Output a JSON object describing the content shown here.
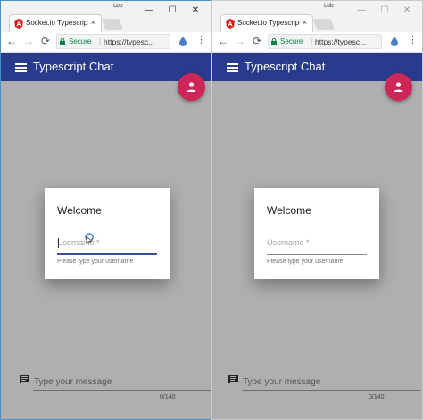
{
  "windows": [
    {
      "user_tag": "Lob",
      "tab": {
        "title": "Socket.io Typescript Cl",
        "close": "×"
      },
      "window_controls": {
        "minimize": "—",
        "maximize": "☐",
        "close": "✕"
      },
      "nav": {
        "back": "←",
        "forward": "→",
        "reload": "⟳"
      },
      "omnibox": {
        "secure_label": "Secure",
        "separator": "|",
        "url": "https://typesc..."
      },
      "menu": "⋮",
      "app": {
        "title": "Typescript Chat"
      },
      "dialog": {
        "title": "Welcome",
        "username_placeholder": "Username *",
        "hint": "Please type your username",
        "focused": true
      },
      "message": {
        "placeholder": "Type your message",
        "counter": "0/140"
      }
    },
    {
      "user_tag": "Lob",
      "tab": {
        "title": "Socket.io Typescript Cl",
        "close": "×"
      },
      "window_controls": {
        "minimize": "—",
        "maximize": "☐",
        "close": "✕"
      },
      "nav": {
        "back": "←",
        "forward": "→",
        "reload": "⟳"
      },
      "omnibox": {
        "secure_label": "Secure",
        "separator": "|",
        "url": "https://typesc..."
      },
      "menu": "⋮",
      "app": {
        "title": "Typescript Chat"
      },
      "dialog": {
        "title": "Welcome",
        "username_placeholder": "Username *",
        "hint": "Please type your username",
        "focused": false
      },
      "message": {
        "placeholder": "Type your message",
        "counter": "0/140"
      }
    }
  ],
  "colors": {
    "app_bar": "#283b8c",
    "fab": "#cf2658",
    "backdrop": "#afaeb0",
    "secure_green": "#0b8043",
    "focus_underline": "#3a4ea0"
  }
}
